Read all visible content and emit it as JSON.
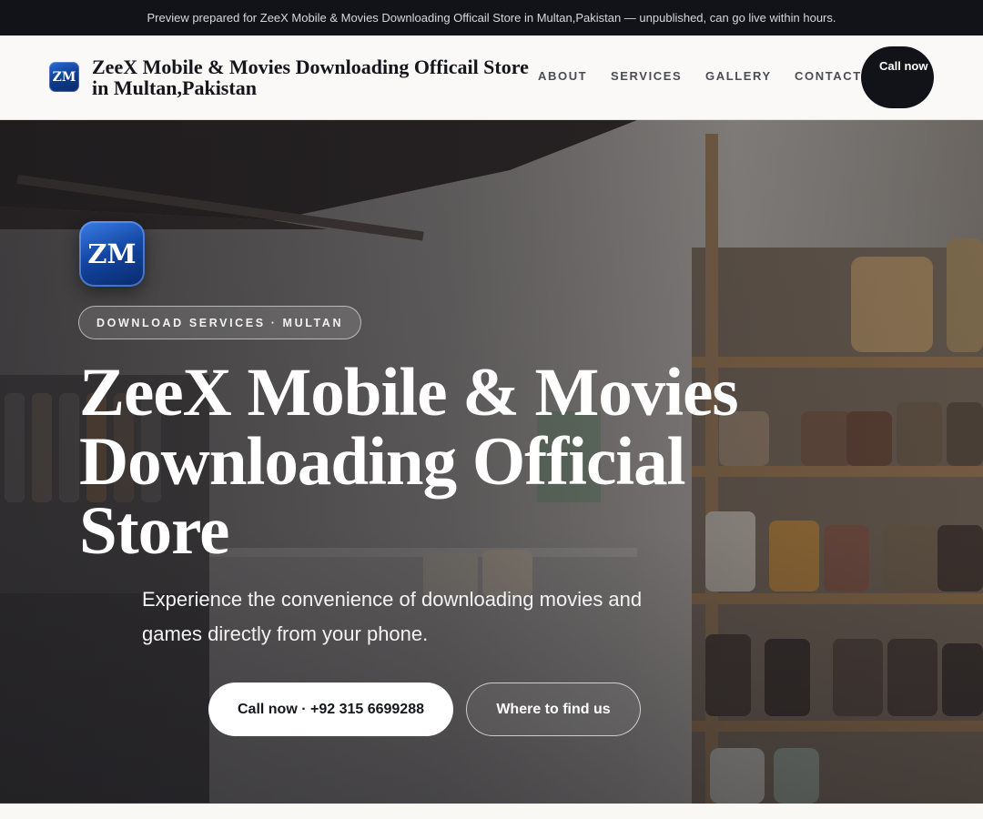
{
  "topbar": {
    "text": "Preview prepared for ZeeX Mobile & Movies Downloading Officail Store in Multan,Pakistan — unpublished, can go live within hours."
  },
  "header": {
    "logo_text": "ZM",
    "brand_name": "ZeeX Mobile & Movies Downloading Officail Store in Multan,Pakistan",
    "nav": {
      "about": "ABOUT",
      "services": "SERVICES",
      "gallery": "GALLERY",
      "contact": "CONTACT"
    },
    "call_label": "Call now"
  },
  "hero": {
    "logo_text": "ZM",
    "badge": "DOWNLOAD SERVICES · MULTAN",
    "title": "ZeeX Mobile & Movies Downloading Official Store",
    "subtitle": "Experience the convenience of downloading movies and games directly from your phone.",
    "primary_button": "Call now · +92 315 6699288",
    "secondary_button": "Where to find us"
  },
  "colors": {
    "dark": "#111318",
    "header_bg": "#faf9f7",
    "logo_blue": "#1244a0"
  },
  "icons": {
    "brand_logo": "zm-logo-icon",
    "hero_logo": "zm-logo-icon"
  }
}
